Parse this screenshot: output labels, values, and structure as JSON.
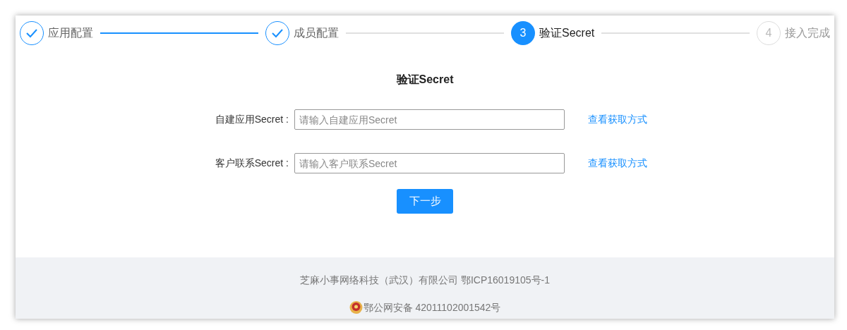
{
  "steps": [
    {
      "label": "应用配置",
      "done": true,
      "selected": false
    },
    {
      "label": "成员配置",
      "done": true,
      "selected": false
    },
    {
      "number": "3",
      "label": "验证Secret",
      "done": false,
      "selected": true
    },
    {
      "number": "4",
      "label": "接入完成",
      "done": false,
      "selected": false
    }
  ],
  "form": {
    "title": "验证Secret",
    "fields": [
      {
        "label": "自建应用Secret :",
        "placeholder": "请输入自建应用Secret",
        "link": "查看获取方式"
      },
      {
        "label": "客户联系Secret :",
        "placeholder": "请输入客户联系Secret",
        "link": "查看获取方式"
      }
    ],
    "button": "下一步"
  },
  "footer": {
    "company": "芝麻小事网络科技（武汉）有限公司 鄂ICP16019105号-1",
    "police": "鄂公网安备 42011102001542号"
  }
}
